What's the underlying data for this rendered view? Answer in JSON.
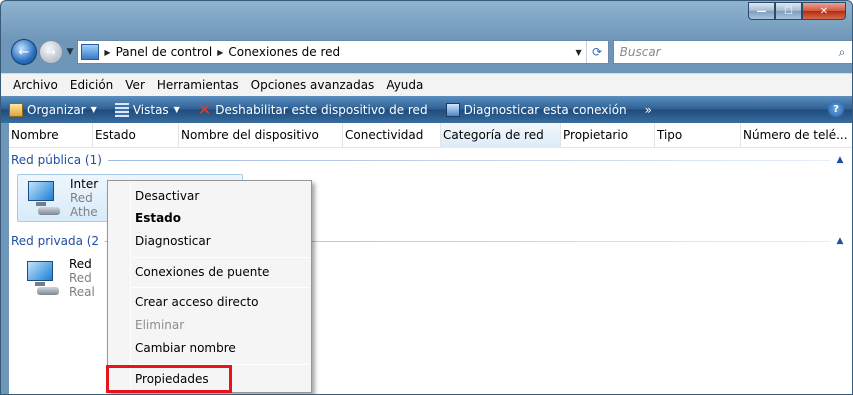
{
  "window": {
    "minimize_icon": "minimize-icon",
    "maximize_icon": "maximize-icon",
    "close_icon": "close-icon",
    "min_glyph": "—",
    "max_glyph": "☐",
    "close_glyph": "✕"
  },
  "address_bar": {
    "back_glyph": "←",
    "forward_glyph": "→",
    "history_glyph": "▼",
    "sep_glyph": "▶",
    "crumbs": [
      "Panel de control",
      "Conexiones de red"
    ],
    "dropdown_glyph": "▼",
    "refresh_glyph": "⟳"
  },
  "search": {
    "placeholder": "Buscar",
    "button_glyph": "⌕"
  },
  "menu": [
    "Archivo",
    "Edición",
    "Ver",
    "Herramientas",
    "Opciones avanzadas",
    "Ayuda"
  ],
  "commands": {
    "organize": "Organizar",
    "views": "Vistas",
    "disable": "Deshabilitar este dispositivo de red",
    "diagnose": "Diagnosticar esta conexión",
    "more": "»",
    "caret": "▼",
    "help_glyph": "?"
  },
  "columns": [
    "Nombre",
    "Estado",
    "Nombre del dispositivo",
    "Conectividad",
    "Categoría de red",
    "Propietario",
    "Tipo",
    "Número de telé..."
  ],
  "groups": [
    {
      "title": "Red pública (1)",
      "collapse_glyph": "▲",
      "item": {
        "name": "Inter",
        "line2": "Red",
        "line3": "Athe"
      }
    },
    {
      "title": "Red privada (2",
      "collapse_glyph": "▲",
      "item": {
        "name": "Red",
        "line2": "Red",
        "line3": "Real"
      }
    }
  ],
  "context_menu": {
    "items": [
      {
        "label": "Desactivar",
        "style": "normal"
      },
      {
        "label": "Estado",
        "style": "bold"
      },
      {
        "label": "Diagnosticar",
        "style": "normal"
      },
      {
        "label": "Conexiones de puente",
        "style": "normal"
      },
      {
        "label": "Crear acceso directo",
        "style": "normal"
      },
      {
        "label": "Eliminar",
        "style": "disabled"
      },
      {
        "label": "Cambiar nombre",
        "style": "normal"
      },
      {
        "label": "Propiedades",
        "style": "highlighted"
      }
    ],
    "highlight_color": "#e8141b"
  }
}
